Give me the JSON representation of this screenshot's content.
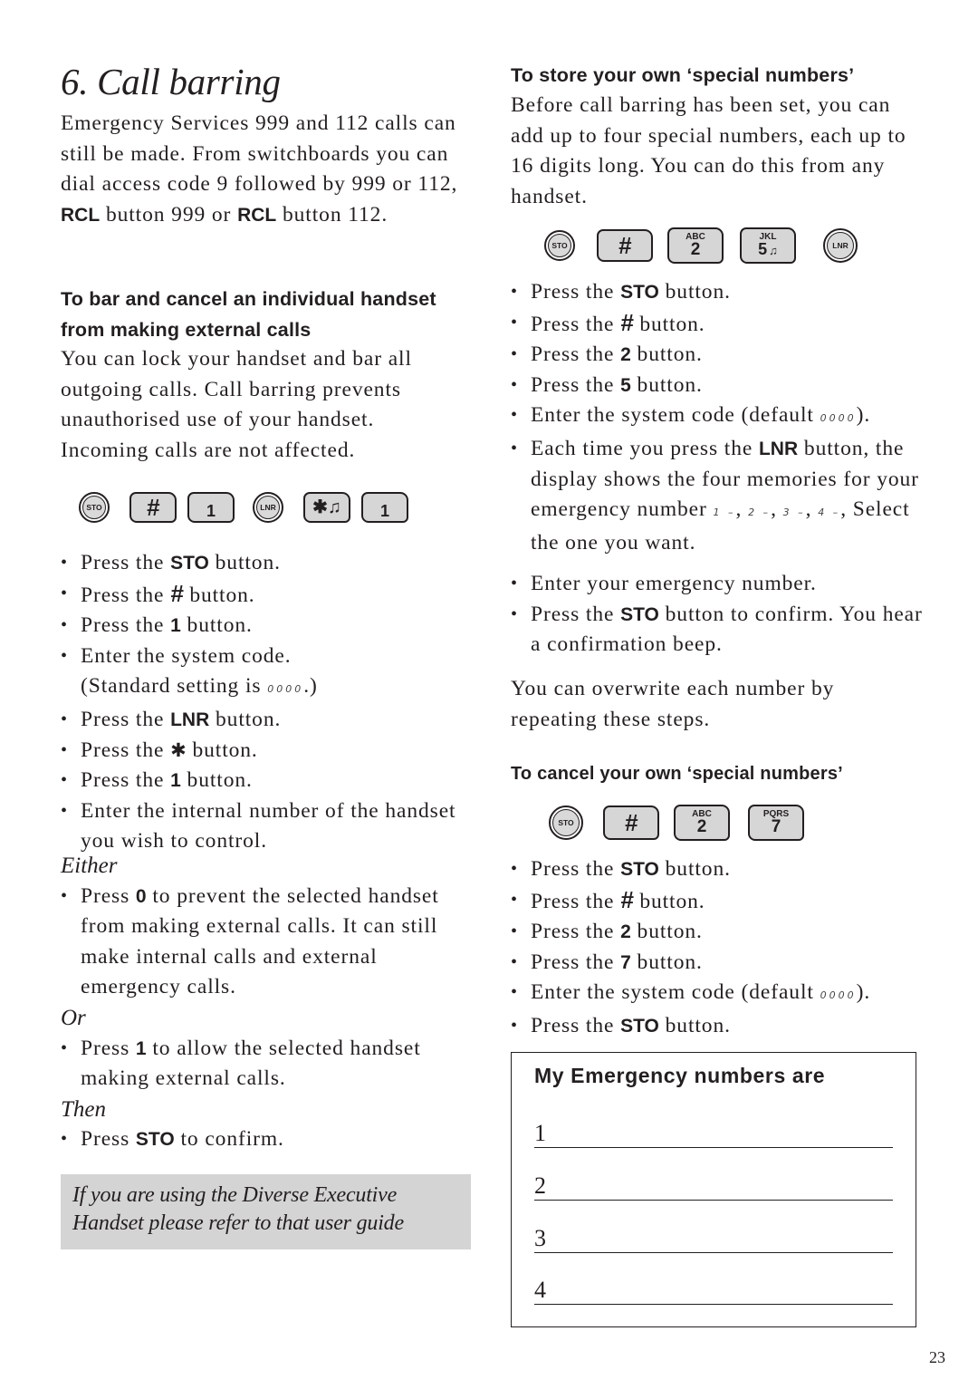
{
  "page": {
    "title": "6. Call barring",
    "page_number": "23"
  },
  "intro": {
    "p1": "Emergency Services 999 and 112 calls can still be made. From switchboards you can dial access code 9 followed by 999 or 112,",
    "rcl1": "RCL",
    "p2": " button 999 or ",
    "rcl2": "RCL",
    "p3": " button 112."
  },
  "bar_section": {
    "heading": "To bar and cancel an individual handset from making external calls",
    "body": "You can lock your handset and bar all outgoing calls. Call barring prevents unauthorised use of your handset. Incoming calls are not affected.",
    "keys": [
      {
        "type": "round",
        "label": "STO",
        "icon": "sto-key-icon"
      },
      {
        "type": "rect",
        "label": "#",
        "icon": "hash-key-icon"
      },
      {
        "type": "rect",
        "label": "1",
        "icon": "one-key-icon"
      },
      {
        "type": "round",
        "label": "LNR",
        "icon": "lnr-key-icon"
      },
      {
        "type": "rect",
        "label": "✱♫",
        "icon": "star-key-icon"
      },
      {
        "type": "rect",
        "label": "1",
        "icon": "one-key-icon"
      }
    ],
    "steps": [
      {
        "pre": "Press the ",
        "bold": "STO",
        "post": " button."
      },
      {
        "pre": "Press the ",
        "bold": "#",
        "post": " button."
      },
      {
        "pre": "Press the ",
        "bold": "1",
        "post": " button."
      },
      {
        "pre": "Enter the system code.",
        "bold": "",
        "post": ""
      },
      {
        "pre": "Press the ",
        "bold": "LNR",
        "post": " button."
      },
      {
        "pre": "Press the ",
        "bold": "✱",
        "post": " button."
      },
      {
        "pre": "Press the ",
        "bold": "1",
        "post": " button."
      },
      {
        "pre": "Enter the internal number of the handset you wish to control.",
        "bold": "",
        "post": ""
      }
    ],
    "standard_setting_pre": "(Standard setting is ",
    "standard_setting_code": "0000",
    "standard_setting_post": ".)",
    "either_label": "Either",
    "either_step": {
      "pre": "Press ",
      "bold": "0",
      "post": " to prevent the selected handset from making external calls. It can still make internal calls and external emergency calls."
    },
    "or_label": "Or",
    "or_step": {
      "pre": "Press ",
      "bold": "1",
      "post": " to allow the selected handset making external calls."
    },
    "then_label": "Then",
    "then_step": {
      "pre": "Press ",
      "bold": "STO",
      "post": " to confirm."
    }
  },
  "note": {
    "text": "If you are using the Diverse Executive Handset please refer to that user guide"
  },
  "store_section": {
    "heading": "To store your own ‘special numbers’",
    "body": "Before call barring has been set, you can add up to four special numbers, each up to 16 digits long. You can do this from any handset.",
    "keys": [
      {
        "type": "round",
        "label": "STO"
      },
      {
        "type": "rect",
        "label": "#"
      },
      {
        "type": "rect",
        "sub": "ABC",
        "label": "2"
      },
      {
        "type": "rect",
        "sub": "JKL",
        "label": "5 🔔"
      },
      {
        "type": "round",
        "label": "LNR"
      }
    ],
    "steps": [
      {
        "pre": "Press the ",
        "bold": "STO",
        "post": " button."
      },
      {
        "pre": "Press the ",
        "bold": "#",
        "post": " button."
      },
      {
        "pre": "Press the ",
        "bold": "2",
        "post": " button."
      },
      {
        "pre": "Press the ",
        "bold": "5",
        "post": " button."
      }
    ],
    "code_step_pre": "Enter the system code (default ",
    "code_step_code": "0000",
    "code_step_post": ").",
    "lnr_step_pre": "Each time you press the ",
    "lnr_step_bold": "LNR",
    "lnr_step_post": " button, the display shows the four memories for your emergency number ",
    "memories": [
      "1 –",
      "2 –",
      "3 –",
      "4 –"
    ],
    "lnr_step_end": ", Select the one you want.",
    "steps2": [
      {
        "pre": "Enter your emergency number.",
        "bold": "",
        "post": ""
      },
      {
        "pre": "Press the ",
        "bold": "STO",
        "post": " button to confirm. You hear a confirmation beep."
      }
    ],
    "overwrite": "You can overwrite each number by repeating these steps."
  },
  "cancel_section": {
    "heading": "To cancel your own ‘special numbers’",
    "keys": [
      {
        "type": "round",
        "label": "STO"
      },
      {
        "type": "rect",
        "label": "#"
      },
      {
        "type": "rect",
        "sub": "ABC",
        "label": "2"
      },
      {
        "type": "rect",
        "sub": "PQRS",
        "label": "7"
      }
    ],
    "steps": [
      {
        "pre": "Press the ",
        "bold": "STO",
        "post": " button."
      },
      {
        "pre": "Press the ",
        "bold": "#",
        "post": " button."
      },
      {
        "pre": "Press the ",
        "bold": "2",
        "post": " button."
      },
      {
        "pre": "Press the ",
        "bold": "7",
        "post": " button."
      }
    ],
    "code_step_pre": "Enter the system code (default ",
    "code_step_code": "0000",
    "code_step_post": ").",
    "final_step": {
      "pre": "Press the ",
      "bold": "STO",
      "post": " button."
    }
  },
  "emergency_box": {
    "heading": "My Emergency numbers are",
    "lines": [
      "1",
      "2",
      "3",
      "4"
    ]
  }
}
